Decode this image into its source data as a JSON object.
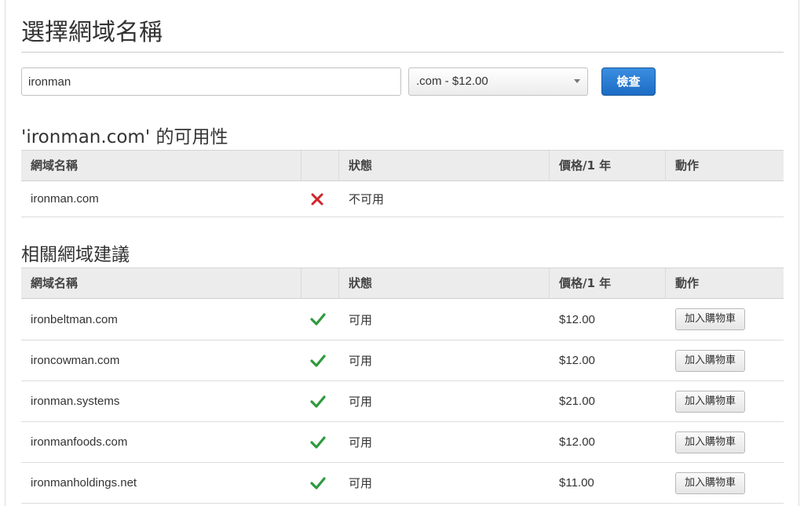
{
  "page": {
    "title": "選擇網域名稱"
  },
  "search": {
    "value": "ironman",
    "tld_selected": ".com - $12.00",
    "check_label": "檢查"
  },
  "availability": {
    "title": "'ironman.com' 的可用性",
    "headers": {
      "domain": "網域名稱",
      "status": "狀態",
      "price": "價格/1 年",
      "action": "動作"
    },
    "row": {
      "domain": "ironman.com",
      "status": "不可用",
      "icon": "x-icon"
    }
  },
  "suggestions": {
    "title": "相關網域建議",
    "headers": {
      "domain": "網域名稱",
      "status": "狀態",
      "price": "價格/1 年",
      "action": "動作"
    },
    "rows": [
      {
        "domain": "ironbeltman.com",
        "status": "可用",
        "price": "$12.00",
        "action": "加入購物車",
        "icon": "check-icon"
      },
      {
        "domain": "ironcowman.com",
        "status": "可用",
        "price": "$12.00",
        "action": "加入購物車",
        "icon": "check-icon"
      },
      {
        "domain": "ironman.systems",
        "status": "可用",
        "price": "$21.00",
        "action": "加入購物車",
        "icon": "check-icon"
      },
      {
        "domain": "ironmanfoods.com",
        "status": "可用",
        "price": "$12.00",
        "action": "加入購物車",
        "icon": "check-icon"
      },
      {
        "domain": "ironmanholdings.net",
        "status": "可用",
        "price": "$11.00",
        "action": "加入購物車",
        "icon": "check-icon"
      }
    ]
  },
  "colors": {
    "primary_button": "#1d6cc5",
    "available": "#2e9a3e",
    "unavailable": "#d0262b"
  }
}
